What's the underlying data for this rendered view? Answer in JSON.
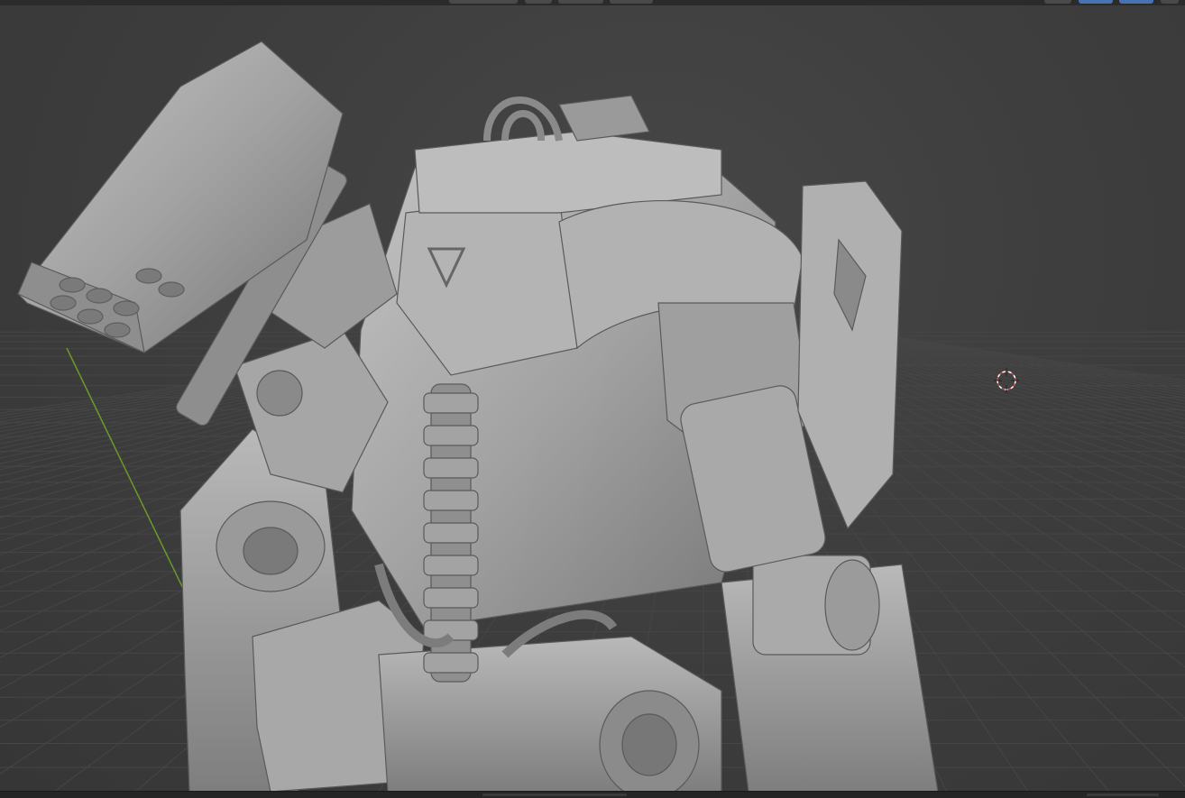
{
  "app": {
    "title": "",
    "mode": "3D Viewport"
  },
  "toolbar": {
    "left_menu_hidden": true,
    "widgets": [
      "view-pivot",
      "snap",
      "proportional-edit",
      "overlays",
      "shading-solid",
      "shading-material"
    ]
  },
  "viewport": {
    "shading": "solid",
    "object": "mech-sculpt",
    "cursor": "3d-cursor-icon"
  },
  "colors": {
    "background": "#3d3d3d",
    "grid": "#464646",
    "y_axis": "#6b9a2a",
    "mesh_light": "#b5b5b5",
    "mesh_mid": "#8d8d8d",
    "mesh_dark": "#5e5e5e",
    "accent_blue": "#4772b3",
    "cursor_red": "#d64646"
  }
}
